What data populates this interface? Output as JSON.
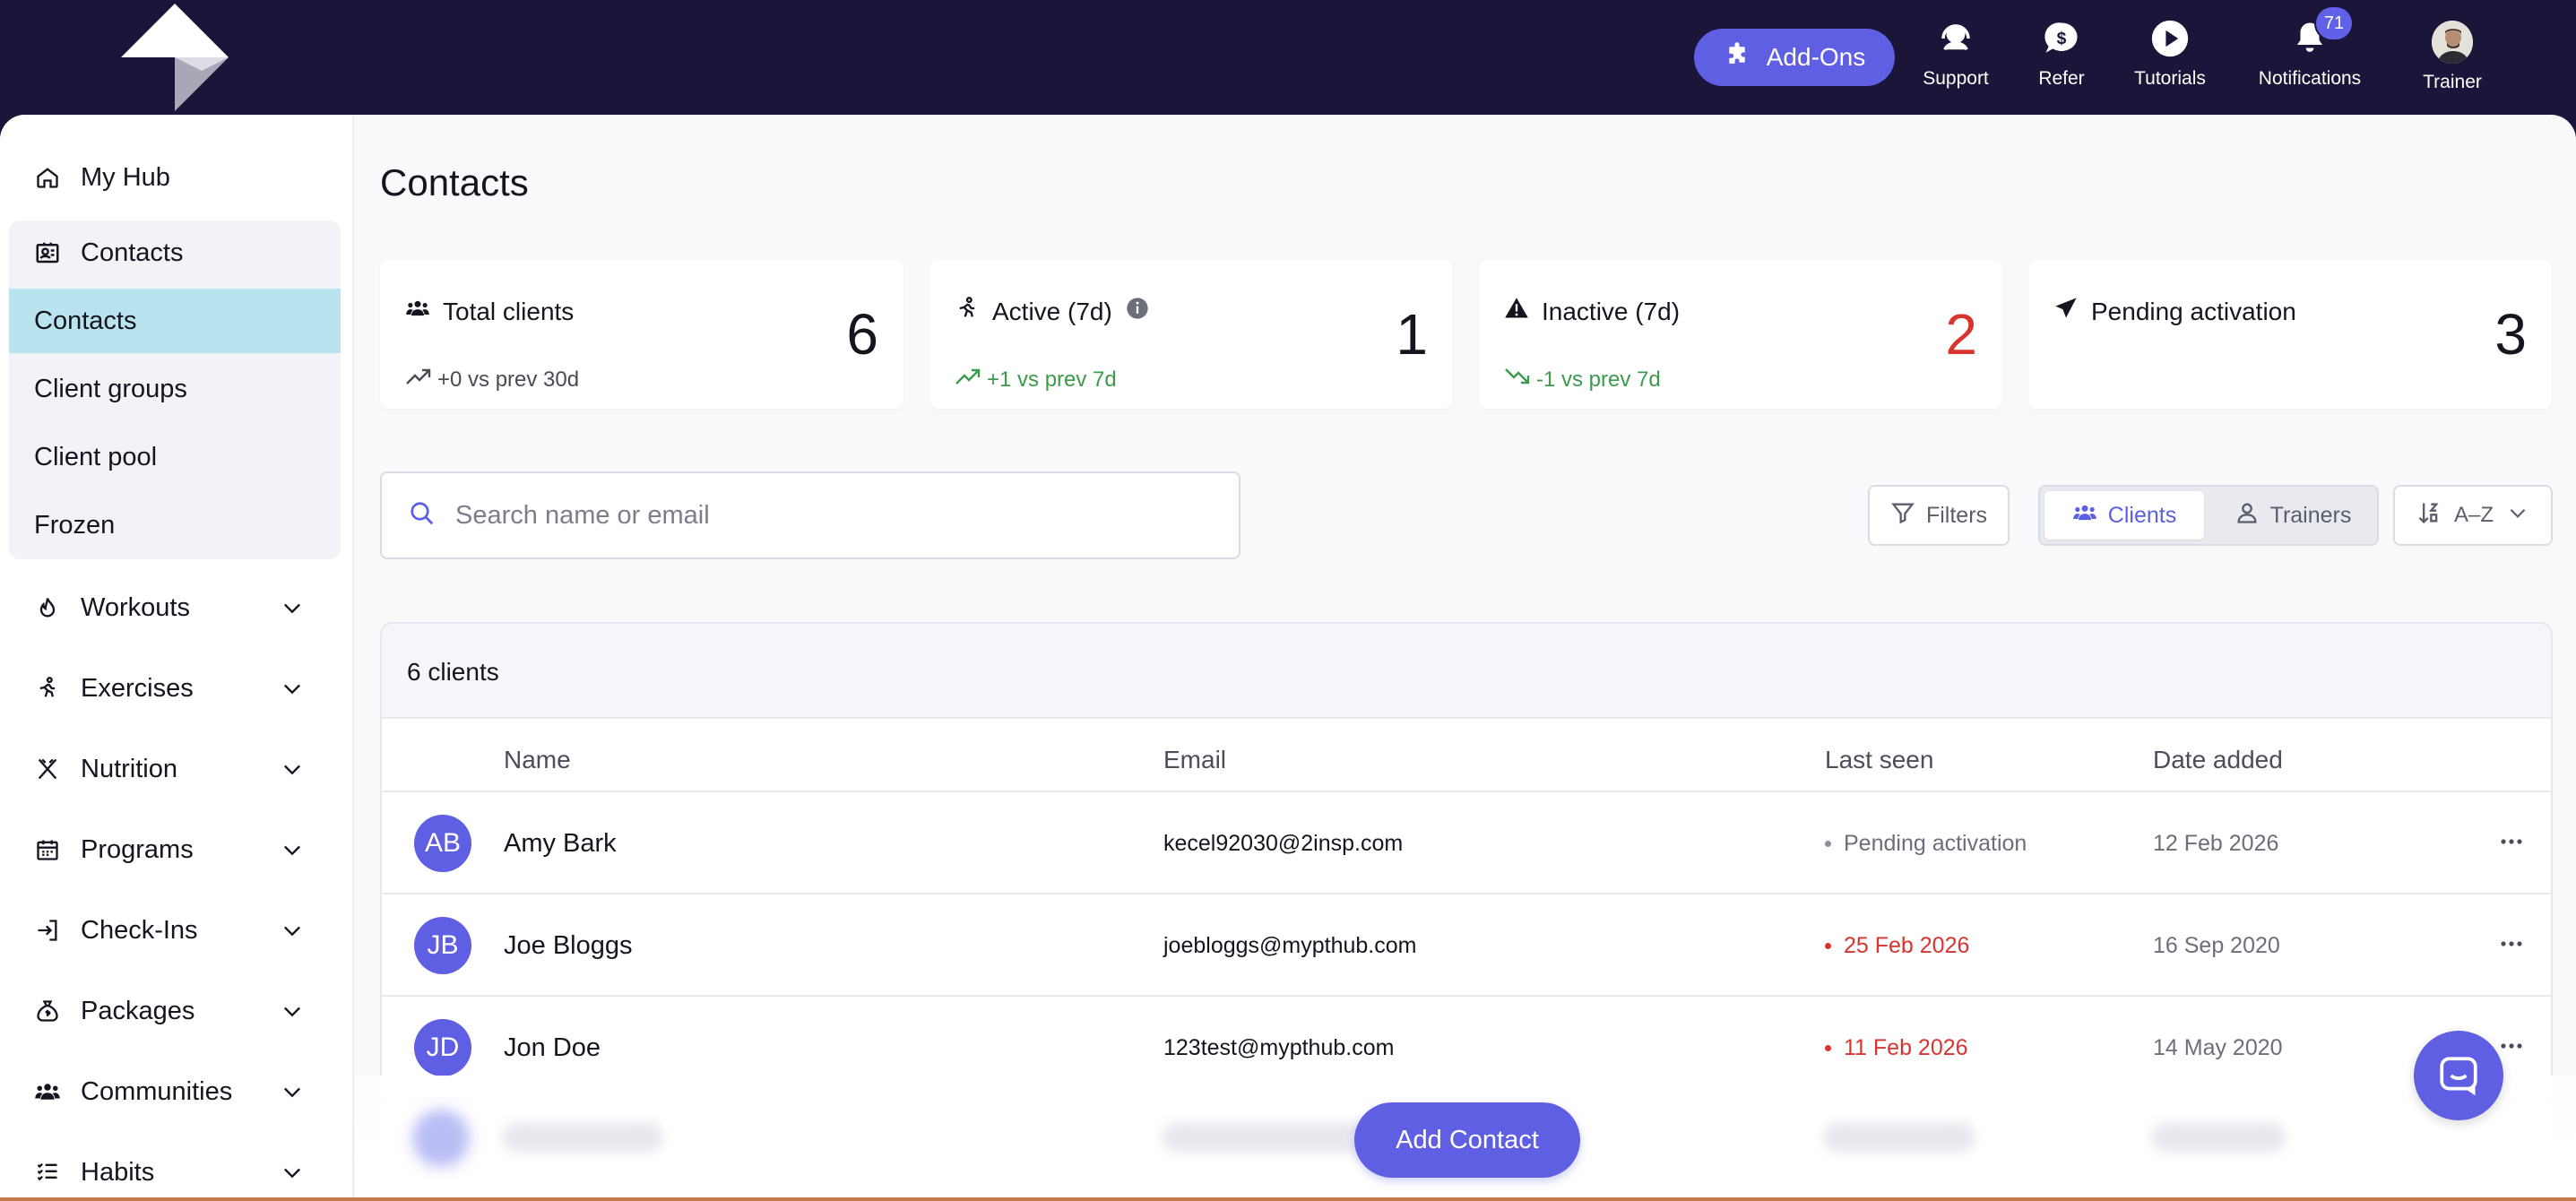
{
  "topbar": {
    "addons_label": "Add-Ons",
    "nav": [
      {
        "label": "Support",
        "icon": "headset-icon"
      },
      {
        "label": "Refer",
        "icon": "dollar-chat-icon"
      },
      {
        "label": "Tutorials",
        "icon": "play-icon"
      },
      {
        "label": "Notifications",
        "icon": "bell-icon",
        "badge": "71"
      },
      {
        "label": "Trainer",
        "icon": "avatar"
      }
    ]
  },
  "sidebar": {
    "my_hub": "My Hub",
    "contacts": "Contacts",
    "sub": [
      "Contacts",
      "Client groups",
      "Client pool",
      "Frozen"
    ],
    "sections": [
      "Workouts",
      "Exercises",
      "Nutrition",
      "Programs",
      "Check-Ins",
      "Packages",
      "Communities",
      "Habits"
    ]
  },
  "page": {
    "title": "Contacts"
  },
  "stats": [
    {
      "title": "Total clients",
      "value": "6",
      "change": "+0 vs prev 30d"
    },
    {
      "title": "Active (7d)",
      "value": "1",
      "change": "+1 vs prev 7d"
    },
    {
      "title": "Inactive (7d)",
      "value": "2",
      "change": "-1 vs prev 7d"
    },
    {
      "title": "Pending activation",
      "value": "3",
      "change": ""
    }
  ],
  "search": {
    "placeholder": "Search name or email"
  },
  "toolbar": {
    "filters": "Filters",
    "clients": "Clients",
    "trainers": "Trainers",
    "sort": "A–Z"
  },
  "table": {
    "count": "6 clients",
    "columns": [
      "Name",
      "Email",
      "Last seen",
      "Date added"
    ],
    "rows": [
      {
        "initials": "AB",
        "name": "Amy Bark",
        "email": "kecel92030@2insp.com",
        "last_seen": "Pending activation",
        "date_added": "12 Feb 2026"
      },
      {
        "initials": "JB",
        "name": "Joe Bloggs",
        "email": "joebloggs@mypthub.com",
        "last_seen": "25 Feb 2026",
        "date_added": "16 Sep 2020"
      },
      {
        "initials": "JD",
        "name": "Jon Doe",
        "email": "123test@mypthub.com",
        "last_seen": "11 Feb 2026",
        "date_added": "14 May 2020"
      }
    ]
  },
  "add_contact": "Add Contact",
  "colors": {
    "brand": "#5f5fe3",
    "nav_bg": "#1b1639",
    "active_sub": "#b9e3ee",
    "danger": "#d9342e",
    "positive": "#3b9b4b"
  }
}
